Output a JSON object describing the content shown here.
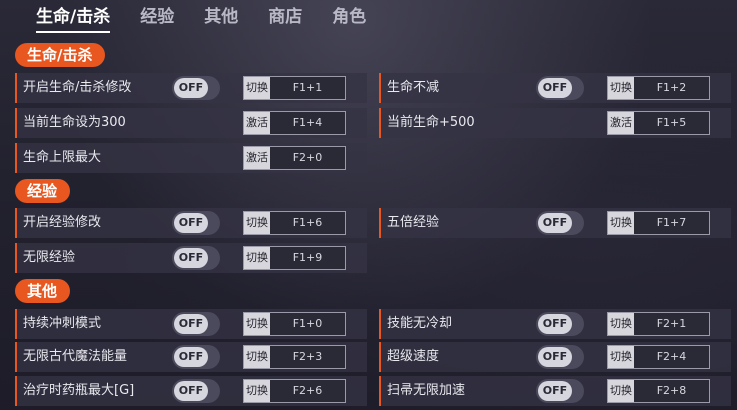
{
  "tabs": [
    "生命/击杀",
    "经验",
    "其他",
    "商店",
    "角色"
  ],
  "sections": [
    {
      "title": "生命/击杀",
      "rows": [
        [
          {
            "label": "开启生命/击杀修改",
            "toggle": "OFF",
            "action": "切换",
            "key": "F1+1"
          },
          {
            "label": "生命不减",
            "toggle": "OFF",
            "action": "切换",
            "key": "F1+2"
          }
        ],
        [
          {
            "label": "当前生命设为300",
            "action": "激活",
            "key": "F1+4"
          },
          {
            "label": "当前生命+500",
            "action": "激活",
            "key": "F1+5"
          }
        ],
        [
          {
            "label": "生命上限最大",
            "action": "激活",
            "key": "F2+0"
          }
        ]
      ]
    },
    {
      "title": "经验",
      "rows": [
        [
          {
            "label": "开启经验修改",
            "toggle": "OFF",
            "action": "切换",
            "key": "F1+6"
          },
          {
            "label": "五倍经验",
            "toggle": "OFF",
            "action": "切换",
            "key": "F1+7"
          }
        ],
        [
          {
            "label": "无限经验",
            "toggle": "OFF",
            "action": "切换",
            "key": "F1+9"
          }
        ]
      ]
    },
    {
      "title": "其他",
      "rows": [
        [
          {
            "label": "持续冲刺模式",
            "toggle": "OFF",
            "action": "切换",
            "key": "F1+0"
          },
          {
            "label": "技能无冷却",
            "toggle": "OFF",
            "action": "切换",
            "key": "F2+1"
          }
        ],
        [
          {
            "label": "无限古代魔法能量",
            "toggle": "OFF",
            "action": "切换",
            "key": "F2+3"
          },
          {
            "label": "超级速度",
            "toggle": "OFF",
            "action": "切换",
            "key": "F2+4"
          }
        ],
        [
          {
            "label": "治疗时药瓶最大[G]",
            "toggle": "OFF",
            "action": "切换",
            "key": "F2+6"
          },
          {
            "label": "扫帚无限加速",
            "toggle": "OFF",
            "action": "切换",
            "key": "F2+8"
          }
        ]
      ]
    }
  ]
}
